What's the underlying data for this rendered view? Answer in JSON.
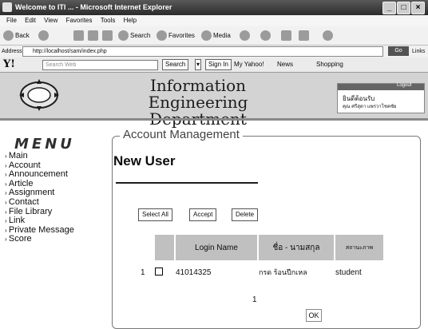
{
  "window": {
    "title": "Welcome to ITI ... - Microsoft Internet Explorer",
    "buttons": {
      "minimize": "_",
      "maximize": "□",
      "close": "×"
    }
  },
  "menubar": [
    "File",
    "Edit",
    "View",
    "Favorites",
    "Tools",
    "Help"
  ],
  "toolbar": {
    "back": "Back",
    "search": "Search",
    "favorites": "Favorites",
    "media": "Media"
  },
  "address": {
    "label": "Address",
    "url": "http://localhost/sam/index.php",
    "go": "Go",
    "links": "Links"
  },
  "yahoo": {
    "logo": "Y!",
    "search_placeholder": "Search Web",
    "search_btn": "Search",
    "signin_btn": "Sign In",
    "items": [
      "My Yahoo!",
      "News",
      "Shopping"
    ]
  },
  "header": {
    "title": "Information Engineering Department",
    "user_welcome": "ยินดีต้อนรับ",
    "user_name": "คุณ ศรีสุดา แพรวาโชคชัย",
    "logout": "Logout"
  },
  "menu": {
    "title": "MENU",
    "items": [
      "Main",
      "Account",
      "Announcement",
      "Article",
      "Assignment",
      "Contact",
      "File Library",
      "Link",
      "Private Message",
      "Score"
    ]
  },
  "panel": {
    "title": "Account Management",
    "heading": "New User",
    "buttons": {
      "select_all": "Select All",
      "accept": "Accept",
      "delete": "Delete"
    }
  },
  "table": {
    "headers": [
      "Login Name",
      "ชื่อ - นามสกุล",
      "สถานะภาพ"
    ],
    "rows": [
      {
        "index": "1",
        "login": "41014325",
        "name": "กรด ร้อนปีกเหล",
        "status": "student"
      }
    ]
  },
  "pagination": {
    "page": "1"
  },
  "ok_label": "OK"
}
